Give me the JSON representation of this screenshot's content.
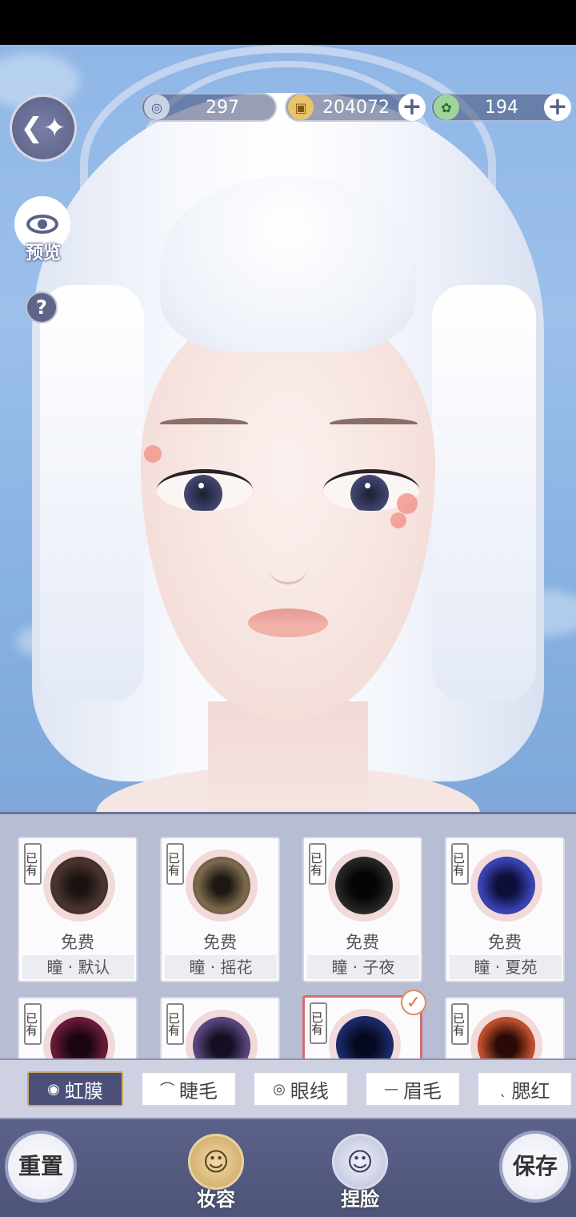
{
  "currencies": [
    {
      "icon": "silver-coin-icon",
      "value": "297",
      "has_plus": false
    },
    {
      "icon": "gold-coin-icon",
      "value": "204072",
      "has_plus": true
    },
    {
      "icon": "jade-token-icon",
      "value": "194",
      "has_plus": true
    }
  ],
  "side": {
    "preview_label": "预览",
    "help_label": "?"
  },
  "items": [
    {
      "tag": "已有",
      "price": "免费",
      "name": "瞳 · 默认",
      "color": "#3b2a28"
    },
    {
      "tag": "已有",
      "price": "免费",
      "name": "瞳 · 摇花",
      "color": "#6d5a44"
    },
    {
      "tag": "已有",
      "price": "免费",
      "name": "瞳 · 子夜",
      "color": "#151515"
    },
    {
      "tag": "已有",
      "price": "免费",
      "name": "瞳 · 夏苑",
      "color": "#2a2f8a"
    },
    {
      "tag": "已有",
      "color": "#3a0f22"
    },
    {
      "tag": "已有",
      "color": "#3a2a55"
    },
    {
      "tag": "已有",
      "color": "#101a4a",
      "selected": true
    },
    {
      "tag": "已有",
      "color": "#8a2c1c"
    }
  ],
  "tabs": [
    {
      "label": "虹膜",
      "icon": "iris-icon",
      "active": true
    },
    {
      "label": "睫毛",
      "icon": "eyelash-icon",
      "active": false
    },
    {
      "label": "眼线",
      "icon": "eyeliner-icon",
      "active": false
    },
    {
      "label": "眉毛",
      "icon": "eyebrow-icon",
      "active": false
    },
    {
      "label": "腮红",
      "icon": "blush-icon",
      "active": false
    }
  ],
  "bottom": {
    "reset_label": "重置",
    "makeup_label": "妆容",
    "face_label": "捏脸",
    "save_label": "保存"
  },
  "colors": {
    "panel_bg": "#b7bdd3",
    "nav_bg": "#5b6188",
    "accent_selected": "#d86b74",
    "tab_active": "#4c4f78"
  }
}
